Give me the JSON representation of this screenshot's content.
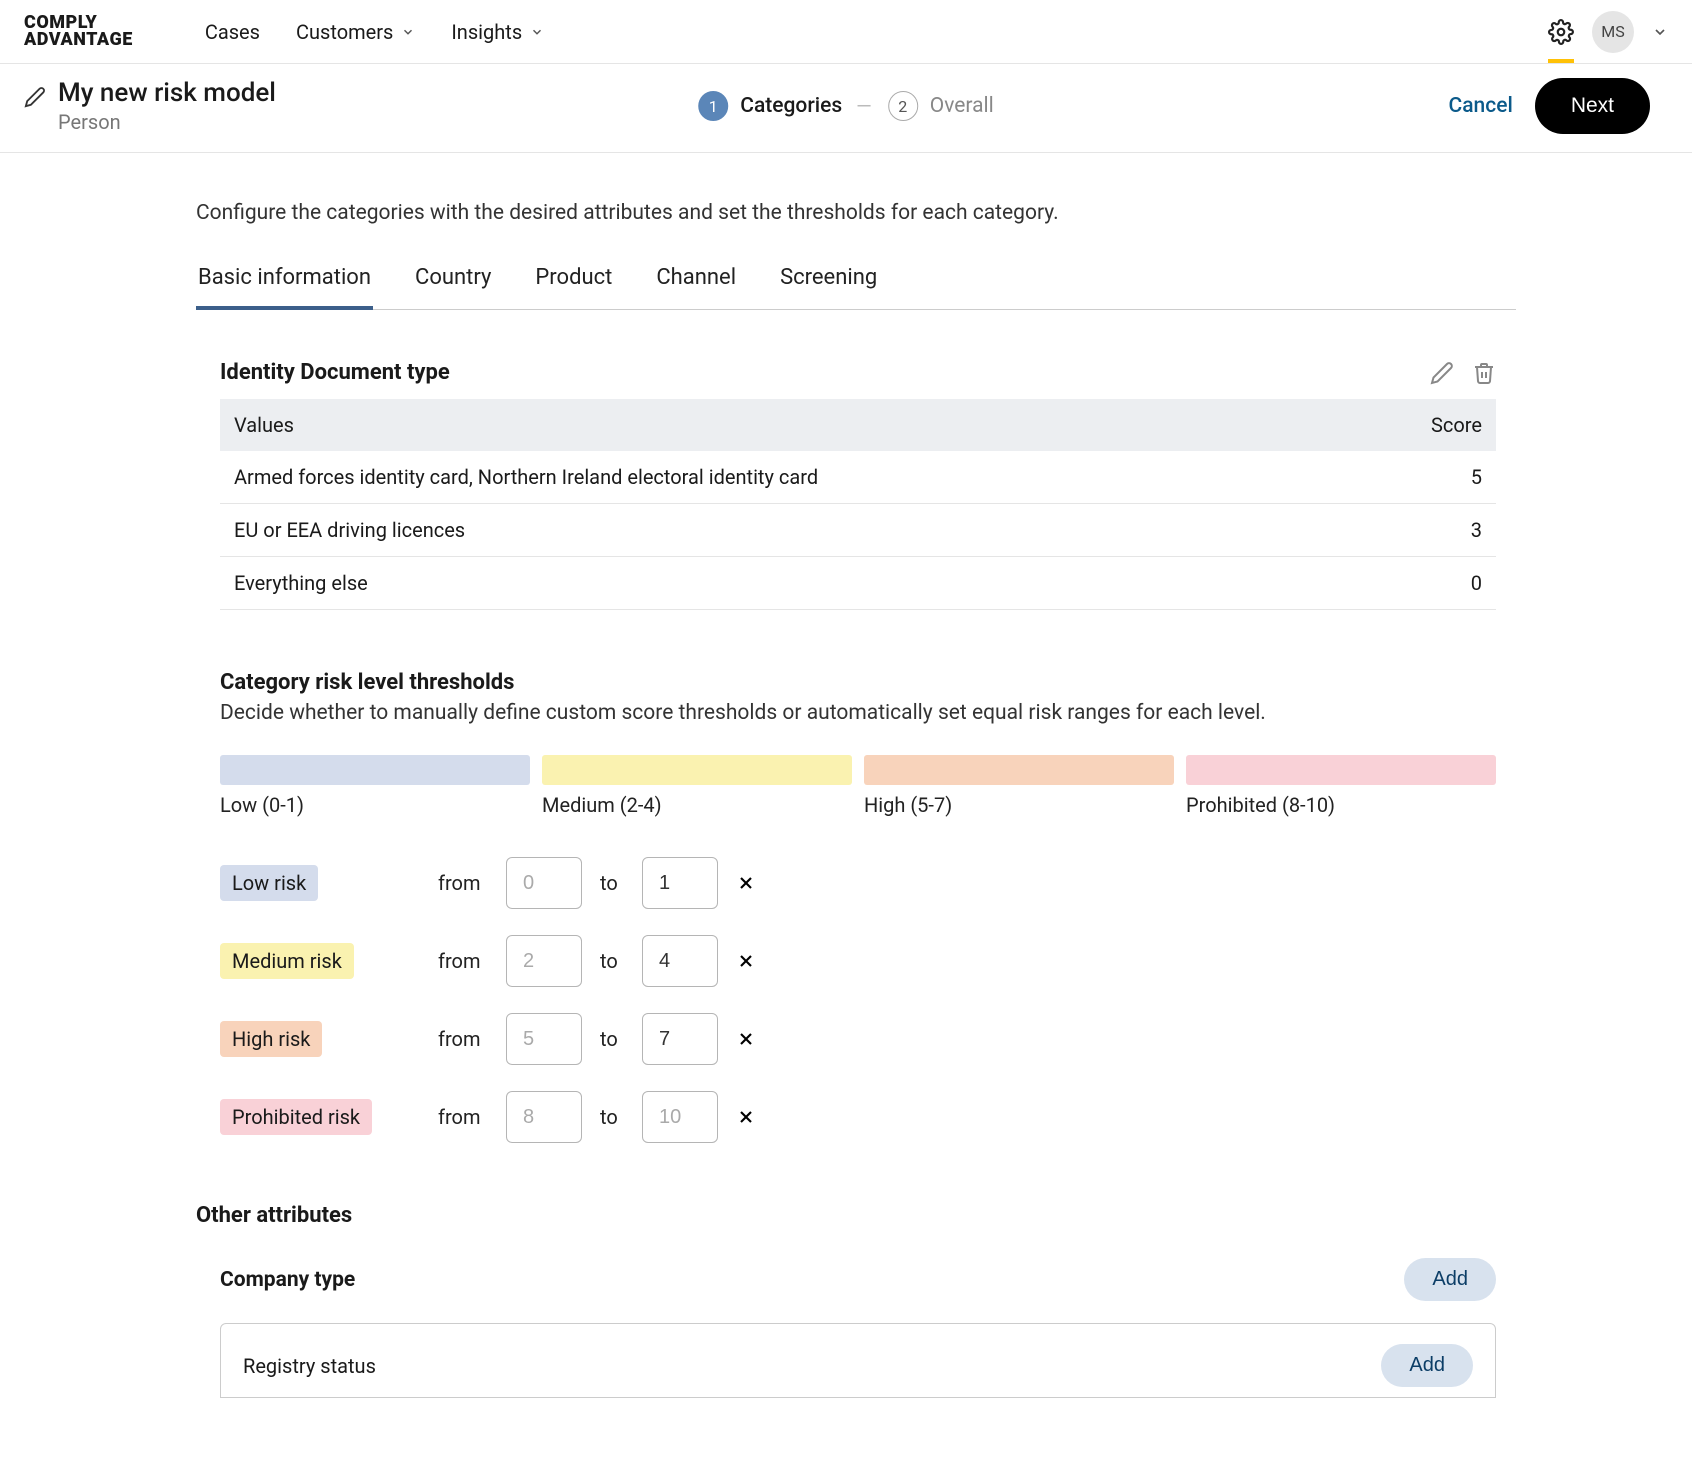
{
  "nav": {
    "brand_line1": "COMPLY",
    "brand_line2": "ADVANTAGE",
    "items": [
      "Cases",
      "Customers",
      "Insights"
    ],
    "avatar": "MS"
  },
  "page": {
    "title": "My new risk model",
    "subtitle": "Person",
    "cancel": "Cancel",
    "next": "Next"
  },
  "stepper": {
    "step1_num": "1",
    "step1_label": "Categories",
    "step2_num": "2",
    "step2_label": "Overall"
  },
  "intro": "Configure the categories with the desired attributes and set the thresholds for each category.",
  "tabs": [
    "Basic information",
    "Country",
    "Product",
    "Channel",
    "Screening"
  ],
  "attribute": {
    "title": "Identity Document type",
    "col_values": "Values",
    "col_score": "Score",
    "rows": [
      {
        "label": "Armed forces identity card, Northern Ireland electoral identity card",
        "score": "5"
      },
      {
        "label": "EU or EEA driving licences",
        "score": "3"
      },
      {
        "label": "Everything else",
        "score": "0"
      }
    ]
  },
  "thresholds": {
    "title": "Category risk level thresholds",
    "desc": "Decide whether to manually define custom score thresholds or automatically set equal risk ranges for each level.",
    "segments": {
      "low": "Low (0-1)",
      "medium": "Medium (2-4)",
      "high": "High (5-7)",
      "prohibited": "Prohibited (8-10)"
    },
    "from_label": "from",
    "to_label": "to",
    "rows": [
      {
        "badge": "Low risk",
        "class": "low",
        "from_ph": "0",
        "to_val": "1"
      },
      {
        "badge": "Medium risk",
        "class": "medium",
        "from_ph": "2",
        "to_val": "4"
      },
      {
        "badge": "High risk",
        "class": "high",
        "from_ph": "5",
        "to_val": "7"
      },
      {
        "badge": "Prohibited risk",
        "class": "prohibited",
        "from_ph": "8",
        "to_ph": "10"
      }
    ]
  },
  "other": {
    "title": "Other attributes",
    "add": "Add",
    "items": [
      {
        "name": "Company type"
      },
      {
        "name": "Registry status"
      }
    ]
  }
}
